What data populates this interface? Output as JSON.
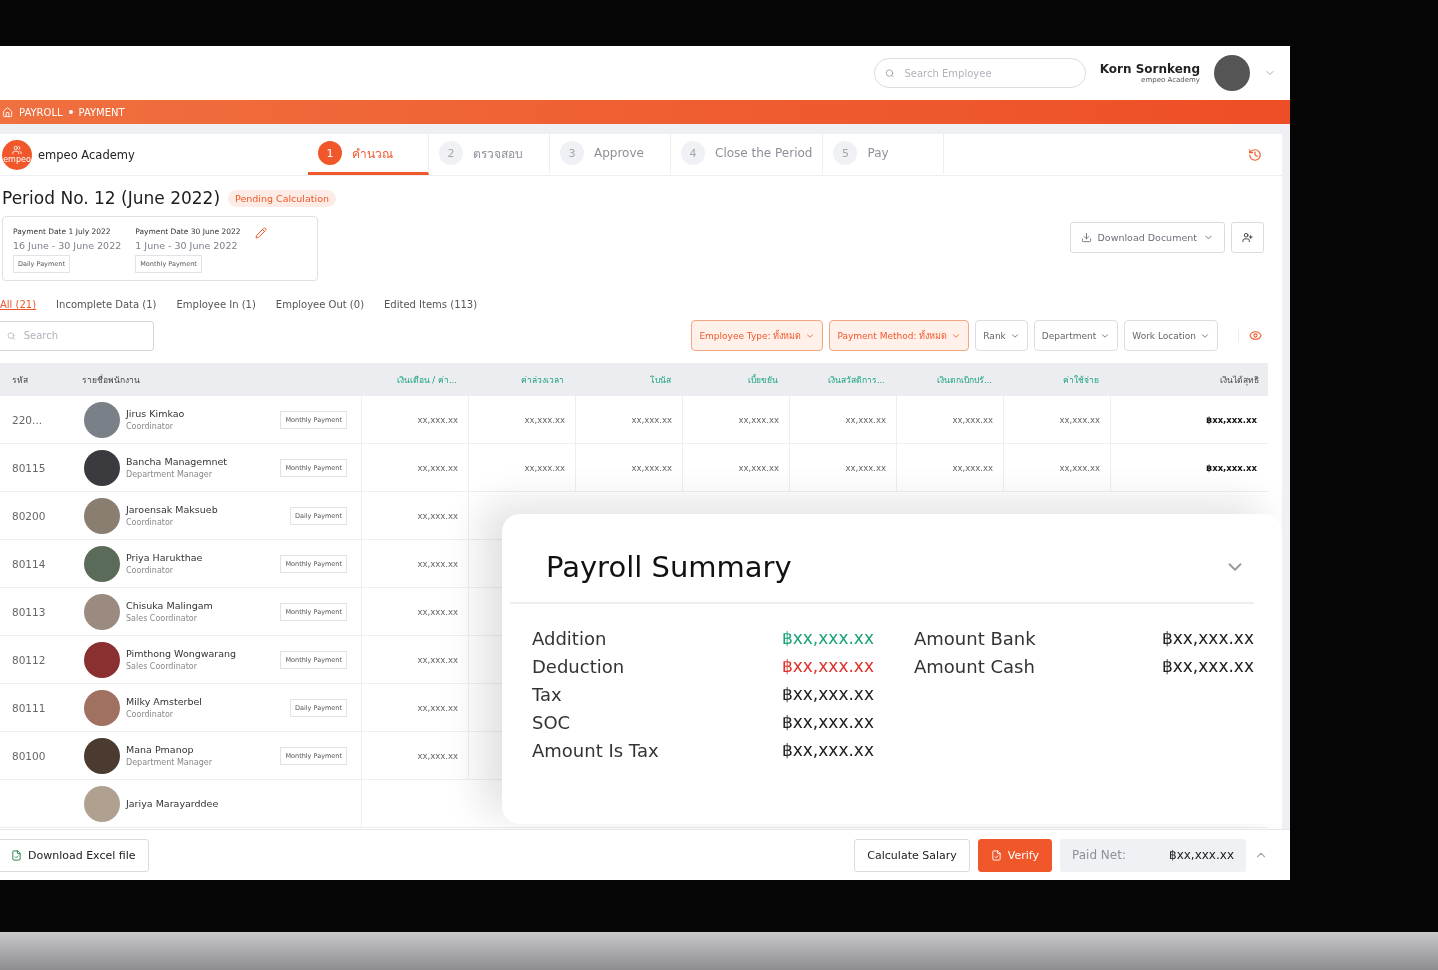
{
  "header": {
    "search": {
      "placeholder": "Search Employee"
    },
    "user": {
      "name": "Korn Sornkeng",
      "company": "empeo Academy"
    }
  },
  "breadcrumb": [
    "PAYROLL",
    "PAYMENT"
  ],
  "company": {
    "logo": "empeo",
    "name": "empeo Academy"
  },
  "steps": [
    {
      "number": "1",
      "label": "คำนวณ",
      "selected": true
    },
    {
      "number": "2",
      "label": "ตรวจสอบ",
      "selected": false
    },
    {
      "number": "3",
      "label": "Approve",
      "selected": false
    },
    {
      "number": "4",
      "label": "Close the Period",
      "selected": false
    },
    {
      "number": "5",
      "label": "Pay",
      "selected": false
    }
  ],
  "period": {
    "title": "Period No. 12 (June 2022)",
    "status": "Pending Calculation"
  },
  "payment_dates": [
    {
      "title": "Payment Date 1 July 2022",
      "range": "16 June - 30 June 2022",
      "type": "Daily Payment"
    },
    {
      "title": "Payment Date 30 June 2022",
      "range": "1 June - 30 June 2022",
      "type": "Monthly Payment"
    }
  ],
  "download_document": "Download Document",
  "filter_tabs": [
    {
      "label": "All (21)",
      "selected": true
    },
    {
      "label": "Incomplete Data (1)",
      "selected": false
    },
    {
      "label": "Employee In (1)",
      "selected": false
    },
    {
      "label": "Employee Out (0)",
      "selected": false
    },
    {
      "label": "Edited Items (113)",
      "selected": false
    }
  ],
  "table_search": {
    "placeholder": "Search"
  },
  "filters": [
    {
      "label": "Employee Type: ทั้งหมด",
      "active": true
    },
    {
      "label": "Payment Method: ทั้งหมด",
      "active": true
    },
    {
      "label": "Rank",
      "active": false
    },
    {
      "label": "Department",
      "active": false
    },
    {
      "label": "Work Location",
      "active": false
    }
  ],
  "table": {
    "columns": [
      "รหัส",
      "รายชื่อพนักงาน",
      "เงินเดือน / ค่า...",
      "ค่าล่วงเวลา",
      "โบนัส",
      "เบี้ยขยัน",
      "เงินสวัสดิการ...",
      "เงินตกเบิกปรั...",
      "ค่าใช้จ่าย",
      "เงินได้สุทธิ"
    ],
    "rows": [
      {
        "id": "220...",
        "name": "Jirus Kimkao",
        "role": "Coordinator",
        "payment": "Monthly Payment",
        "values": [
          "xx,xxx.xx",
          "xx,xxx.xx",
          "xx,xxx.xx",
          "xx,xxx.xx",
          "xx,xxx.xx",
          "xx,xxx.xx",
          "xx,xxx.xx"
        ],
        "net": "฿xx,xxx.xx"
      },
      {
        "id": "80115",
        "name": "Bancha Managemnet",
        "role": "Department Manager",
        "payment": "Monthly Payment",
        "values": [
          "xx,xxx.xx",
          "xx,xxx.xx",
          "xx,xxx.xx",
          "xx,xxx.xx",
          "xx,xxx.xx",
          "xx,xxx.xx",
          "xx,xxx.xx"
        ],
        "net": "฿xx,xxx.xx"
      },
      {
        "id": "80200",
        "name": "Jaroensak Maksueb",
        "role": "Coordinator",
        "payment": "Daily Payment",
        "values": [
          "xx,xxx.xx"
        ]
      },
      {
        "id": "80114",
        "name": "Priya Harukthae",
        "role": "Coordinator",
        "payment": "Monthly Payment",
        "values": [
          "xx,xxx.xx"
        ]
      },
      {
        "id": "80113",
        "name": "Chisuka Malingam",
        "role": "Sales Coordinator",
        "payment": "Monthly Payment",
        "values": [
          "xx,xxx.xx"
        ]
      },
      {
        "id": "80112",
        "name": "Pimthong Wongwarang",
        "role": "Sales Coordinator",
        "payment": "Monthly Payment",
        "values": [
          "xx,xxx.xx"
        ]
      },
      {
        "id": "80111",
        "name": "Milky Amsterbel",
        "role": "Coordinator",
        "payment": "Daily Payment",
        "values": [
          "xx,xxx.xx"
        ]
      },
      {
        "id": "80100",
        "name": "Mana Pmanop",
        "role": "Department Manager",
        "payment": "Monthly Payment",
        "values": [
          "xx,xxx.xx"
        ]
      },
      {
        "name": "Jariya Marayarddee"
      }
    ]
  },
  "summary": {
    "title": "Payroll Summary",
    "items": [
      {
        "label": "Addition",
        "value": "฿xx,xxx.xx",
        "kind": "positive"
      },
      {
        "label": "Deduction",
        "value": "฿xx,xxx.xx",
        "kind": "negative"
      },
      {
        "label": "Tax",
        "value": "฿xx,xxx.xx",
        "kind": "plain"
      },
      {
        "label": "SOC",
        "value": "฿xx,xxx.xx",
        "kind": "plain"
      },
      {
        "label": "Amount Is Tax",
        "value": "฿xx,xxx.xx",
        "kind": "plain"
      }
    ],
    "totals": [
      {
        "label": "Amount Bank",
        "value": "฿xx,xxx.xx"
      },
      {
        "label": "Amount Cash",
        "value": "฿xx,xxx.xx"
      }
    ]
  },
  "footer": {
    "excel": "Download Excel file",
    "calculate": "Calculate Salary",
    "verify": "Verify",
    "paid_net_label": "Paid Net:",
    "paid_net": "฿xx,xxx.xx"
  }
}
